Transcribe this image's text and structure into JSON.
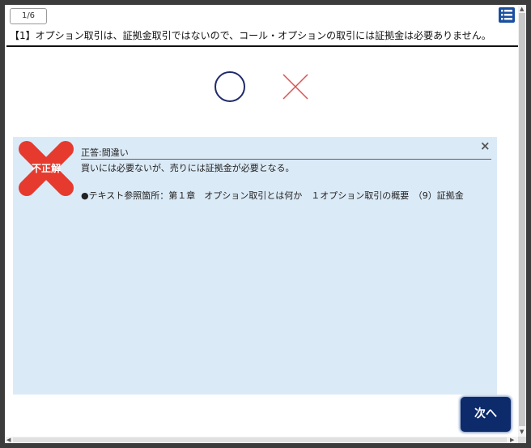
{
  "header": {
    "counter": "1/6",
    "menu_icon": "list-menu-icon"
  },
  "question": {
    "text": "【1】オプション取引は、証拠金取引ではないので、コール・オプションの取引には証拠金は必要ありません。"
  },
  "choices": {
    "true_icon": "circle-icon",
    "false_icon": "cross-icon"
  },
  "result": {
    "mark_label": "不正解",
    "answer_title": "正答:間違い",
    "explanation": "買いには必要ないが、売りには証拠金が必要となる。",
    "reference": "●テキスト参照箇所：第１章　オプション取引とは何か　１オプション取引の概要　（9）証拠金",
    "close_label": "×"
  },
  "footer": {
    "next_label": "次へ"
  },
  "colors": {
    "accent_navy": "#0d2a6b",
    "menu_blue": "#1a4fa0",
    "wrong_red": "#e63a2e",
    "panel_bg": "#dbeaf7",
    "circle_navy": "#1f2a6b",
    "cross_red": "#d9534f"
  }
}
